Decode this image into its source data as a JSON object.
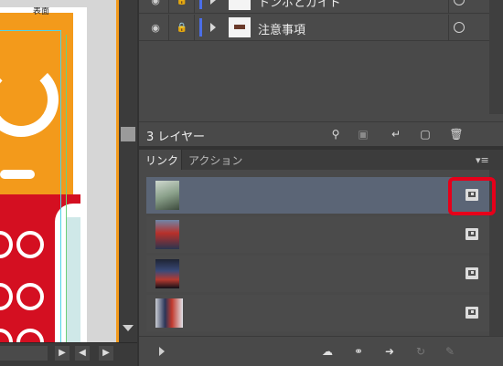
{
  "artboard": {
    "label": "表面"
  },
  "layers_panel": {
    "layers": [
      {
        "name": "トンボとガイド"
      },
      {
        "name": "注意事項"
      }
    ],
    "count_label": "3 レイヤー",
    "footer_icons": [
      "search-icon",
      "clipping-mask-icon",
      "sublayer-icon",
      "new-layer-icon",
      "trash-icon"
    ]
  },
  "links_panel": {
    "tabs": [
      {
        "label": "リンク",
        "active": true
      },
      {
        "label": "アクション",
        "active": false
      }
    ],
    "rows": [
      {
        "selected": true
      },
      {
        "selected": false
      },
      {
        "selected": false
      },
      {
        "selected": false
      }
    ],
    "highlight_color": "#e6001a",
    "footer_icons": [
      "cc-libraries-icon",
      "relink-icon",
      "go-to-link-icon",
      "update-link-icon",
      "edit-original-icon"
    ]
  },
  "colors": {
    "panel_bg": "#494949",
    "selected_row": "#5b6576",
    "layer_color": "#4b6ee8",
    "art_orange": "#f39a1b",
    "art_red": "#d40f21"
  }
}
